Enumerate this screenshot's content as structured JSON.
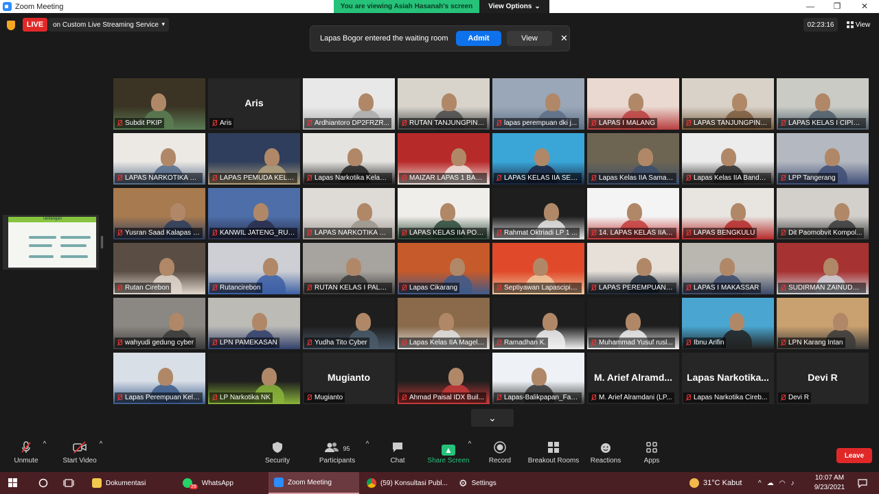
{
  "window": {
    "title": "Zoom Meeting",
    "min": "—",
    "max": "❐",
    "close": "✕"
  },
  "share_banner": {
    "text": "You are viewing Asiah Hasanah's screen",
    "options": "View Options",
    "options_caret": "⌄"
  },
  "topbar": {
    "live": "LIVE",
    "stream": "on Custom Live Streaming Service",
    "stream_caret": "▾",
    "timer": "02:23:16",
    "view": "View",
    "view_icon": "grid-icon"
  },
  "notification": {
    "message": "Lapas Bogor entered the waiting room",
    "admit": "Admit",
    "view": "View",
    "close": "✕"
  },
  "shared_slide": {
    "title": "Tantangan"
  },
  "participants": [
    {
      "name": "Subdit PKIP",
      "active": true,
      "scene": [
        "#3b3424",
        "#5a7c54"
      ]
    },
    {
      "name": "Aris",
      "big": "Aris"
    },
    {
      "name": "Ardhiantoro DP2FRZR...",
      "scene": [
        "#e8e8e8",
        "#aaa"
      ]
    },
    {
      "name": "RUTAN TANJUNGPINA...",
      "scene": [
        "#d8d4cc",
        "#4a4a4a"
      ]
    },
    {
      "name": "lapas perempuan dki j...",
      "scene": [
        "#9aa7b8",
        "#5d6e85"
      ]
    },
    {
      "name": "LAPAS I MALANG",
      "scene": [
        "#e9d9d0",
        "#b93f3f"
      ]
    },
    {
      "name": "LAPAS TANJUNGPINA...",
      "scene": [
        "#d8d2c8",
        "#7a5b3c"
      ]
    },
    {
      "name": "LAPAS KELAS I CIPINA...",
      "scene": [
        "#c9cbc4",
        "#4e5d6a"
      ]
    },
    {
      "name": "LAPAS NARKOTIKA GN...",
      "scene": [
        "#ece9e4",
        "#556b88"
      ]
    },
    {
      "name": "LAPAS PEMUDA KELA...",
      "scene": [
        "#2e3e5c",
        "#b4a27c"
      ]
    },
    {
      "name": "Lapas Narkotika Kelas ...",
      "scene": [
        "#e5e3e0",
        "#222"
      ]
    },
    {
      "name": "MAIZAR LAPAS 1 BAN...",
      "scene": [
        "#b72a2a",
        "#f0e6e0"
      ]
    },
    {
      "name": "LAPAS KELAS IIA SERA...",
      "scene": [
        "#3aa6d8",
        "#1b2540"
      ]
    },
    {
      "name": "Lapas Kelas IIA Samari...",
      "scene": [
        "#6d6552",
        "#3c4d6b"
      ]
    },
    {
      "name": "Lapas Kelas IIA Banda ...",
      "scene": [
        "#ececec",
        "#2a2a2a"
      ]
    },
    {
      "name": "LPP Tangerang",
      "scene": [
        "#b4b8c0",
        "#3e4e76"
      ]
    },
    {
      "name": "Yusran Saad Kalapas N...",
      "scene": [
        "#a77a4f",
        "#2d3e5e"
      ]
    },
    {
      "name": "KANWIL JATENG_RUT...",
      "scene": [
        "#4d6ea8",
        "#2a2e4a"
      ]
    },
    {
      "name": "LAPAS NARKOTIKA KE...",
      "scene": [
        "#dedad6",
        "#9a948c"
      ]
    },
    {
      "name": "LAPAS KELAS IIA PON...",
      "scene": [
        "#f0eeea",
        "#2d4a3a"
      ]
    },
    {
      "name": "Rahmat Oktriadi LP 1 ...",
      "scene": [
        "#1e1e1e",
        "#e8e8e8"
      ]
    },
    {
      "name": "14. LAPAS KELAS IIA P...",
      "scene": [
        "#f4f4f4",
        "#c43a3a"
      ]
    },
    {
      "name": "LAPAS BENGKULU",
      "scene": [
        "#e8e4e0",
        "#b52a2a"
      ]
    },
    {
      "name": "Dit Paomobvit Kompol...",
      "scene": [
        "#d3d0cc",
        "#3a3a3a"
      ]
    },
    {
      "name": "Rutan Cirebon",
      "scene": [
        "#5a4e44",
        "#e0d6cc"
      ]
    },
    {
      "name": "Rutancirebon",
      "scene": [
        "#cdcfd4",
        "#3c5fa4"
      ]
    },
    {
      "name": "RUTAN KELAS I PALEM...",
      "scene": [
        "#a7a39e",
        "#3a3a3a"
      ]
    },
    {
      "name": "Lapas Cikarang",
      "scene": [
        "#c75a2a",
        "#3f5a8a"
      ]
    },
    {
      "name": "Septiyawan Lapascipin...",
      "scene": [
        "#e04a2a",
        "#f0c8a0"
      ]
    },
    {
      "name": "LAPAS PEREMPUAN K...",
      "scene": [
        "#e6e0d8",
        "#1e2a3a"
      ]
    },
    {
      "name": "LAPAS I MAKASSAR",
      "scene": [
        "#bab6b0",
        "#3b4a6a"
      ]
    },
    {
      "name": "SUDIRMAN ZAINUDDI...",
      "scene": [
        "#a73232",
        "#d0d4da"
      ]
    },
    {
      "name": "wahyudi gedung cyber",
      "scene": [
        "#8b8782",
        "#3a3a3a"
      ]
    },
    {
      "name": "LPN PAMEKASAN",
      "scene": [
        "#bdbbb6",
        "#31406a"
      ]
    },
    {
      "name": "Yudha Tito Cyber",
      "scene": [
        "#1e1e1e",
        "#4a5a6a"
      ]
    },
    {
      "name": "Lapas Kelas IIA Magela...",
      "scene": [
        "#8a6a4a",
        "#e0e0e0"
      ]
    },
    {
      "name": "Ramadhan K.",
      "scene": [
        "#1e1e1e",
        "#f0f0f0"
      ]
    },
    {
      "name": "Muhammad Yusuf rusl...",
      "scene": [
        "#1e1e1e",
        "#f0f0f0"
      ]
    },
    {
      "name": "Ibnu Arifin",
      "scene": [
        "#4aa6d0",
        "#222"
      ]
    },
    {
      "name": "LPN Karang Intan",
      "scene": [
        "#c9a070",
        "#3a3a3a"
      ]
    },
    {
      "name": "Lapas Perempuan Kela...",
      "scene": [
        "#d8dfe6",
        "#3a5a8a"
      ]
    },
    {
      "name": "LP Narkotika NK",
      "scene": [
        "#1e1e1e",
        "#8ab43a"
      ]
    },
    {
      "name": "Mugianto",
      "big": "Mugianto"
    },
    {
      "name": "Ahmad Paisal IDX Buil...",
      "scene": [
        "#1e1e1e",
        "#c83a3a"
      ]
    },
    {
      "name": "Lapas-Balikpapan_Fadl...",
      "scene": [
        "#eef2f6",
        "#333"
      ]
    },
    {
      "name": "M. Arief Alramdani (LP...",
      "big": "M. Arief Alramd..."
    },
    {
      "name": "Lapas Narkotika Cireb...",
      "big": "Lapas Narkotika..."
    },
    {
      "name": "Devi R",
      "big": "Devi R"
    }
  ],
  "more": "⌄",
  "toolbar": {
    "unmute": "Unmute",
    "start_video": "Start Video",
    "security": "Security",
    "participants": "Participants",
    "participants_count": "95",
    "chat": "Chat",
    "share_screen": "Share Screen",
    "record": "Record",
    "breakout": "Breakout Rooms",
    "reactions": "Reactions",
    "apps": "Apps",
    "leave": "Leave",
    "caret": "^"
  },
  "taskbar": {
    "dokumentasi": "Dokumentasi",
    "whatsapp": "WhatsApp",
    "whatsapp_badge": "29",
    "zoom": "Zoom Meeting",
    "chrome": "(59) Konsultasi Publ...",
    "settings": "Settings",
    "weather": "31°C  Kabut",
    "time": "10:07 AM",
    "date": "9/23/2021"
  },
  "colors": {
    "live": "#e02828",
    "admit": "#0e72ed",
    "share_green": "#26c27a",
    "taskbar": "#4a1f24"
  }
}
